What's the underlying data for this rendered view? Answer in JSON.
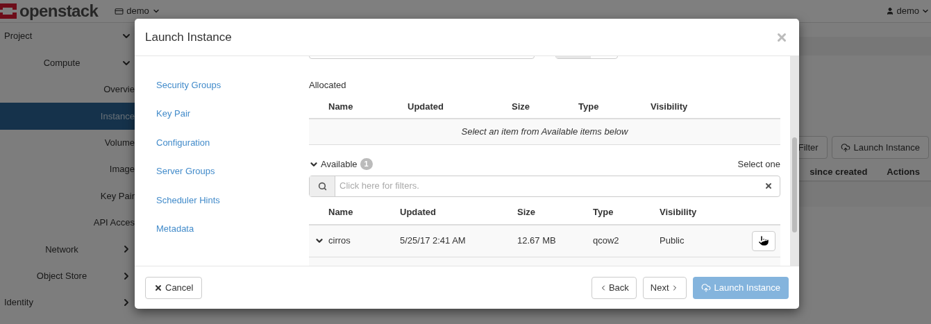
{
  "header": {
    "logo": "openstack",
    "project_menu": "demo",
    "user_menu": "demo"
  },
  "sidebar": {
    "items": [
      {
        "label": "Project",
        "selected": false,
        "expanded": true,
        "children": [
          {
            "label": "Compute",
            "selected": false,
            "expanded": true,
            "children": [
              {
                "label": "Overvie",
                "selected": false
              },
              {
                "label": "Instance",
                "selected": true
              },
              {
                "label": "Volume",
                "selected": false
              },
              {
                "label": "Image",
                "selected": false
              },
              {
                "label": "Key Pair",
                "selected": false
              },
              {
                "label": "API Acces",
                "selected": false
              }
            ]
          },
          {
            "label": "Network",
            "selected": false,
            "expanded": false
          },
          {
            "label": "Object Store",
            "selected": false,
            "expanded": false
          }
        ]
      },
      {
        "label": "Identity",
        "selected": false,
        "expanded": false
      }
    ]
  },
  "page": {
    "buttons": [
      {
        "label": "Filter",
        "kind": "plain"
      },
      {
        "label": "Launch Instance",
        "kind": "launch"
      }
    ],
    "table_columns": [
      "since created",
      "Actions"
    ]
  },
  "modal": {
    "title": "Launch Instance",
    "steps": [
      "Security Groups",
      "Key Pair",
      "Configuration",
      "Server Groups",
      "Scheduler Hints",
      "Metadata"
    ],
    "allocated": {
      "label": "Allocated",
      "columns": [
        "Name",
        "Updated",
        "Size",
        "Type",
        "Visibility"
      ],
      "empty_text": "Select an item from Available items below"
    },
    "available": {
      "label": "Available",
      "count": "1",
      "expanded": true,
      "hint": "Select one",
      "filter": {
        "placeholder": "Click here for filters."
      },
      "columns": [
        "Name",
        "Updated",
        "Size",
        "Type",
        "Visibility"
      ],
      "rows": [
        {
          "name": "cirros",
          "updated": "5/25/17 2:41 AM",
          "size": "12.67 MB",
          "type": "qcow2",
          "visibility": "Public",
          "expanded": true
        }
      ]
    },
    "footer": {
      "cancel": "Cancel",
      "back": "Back",
      "next": "Next",
      "launch": {
        "label": "Launch Instance",
        "disabled": true
      }
    }
  }
}
